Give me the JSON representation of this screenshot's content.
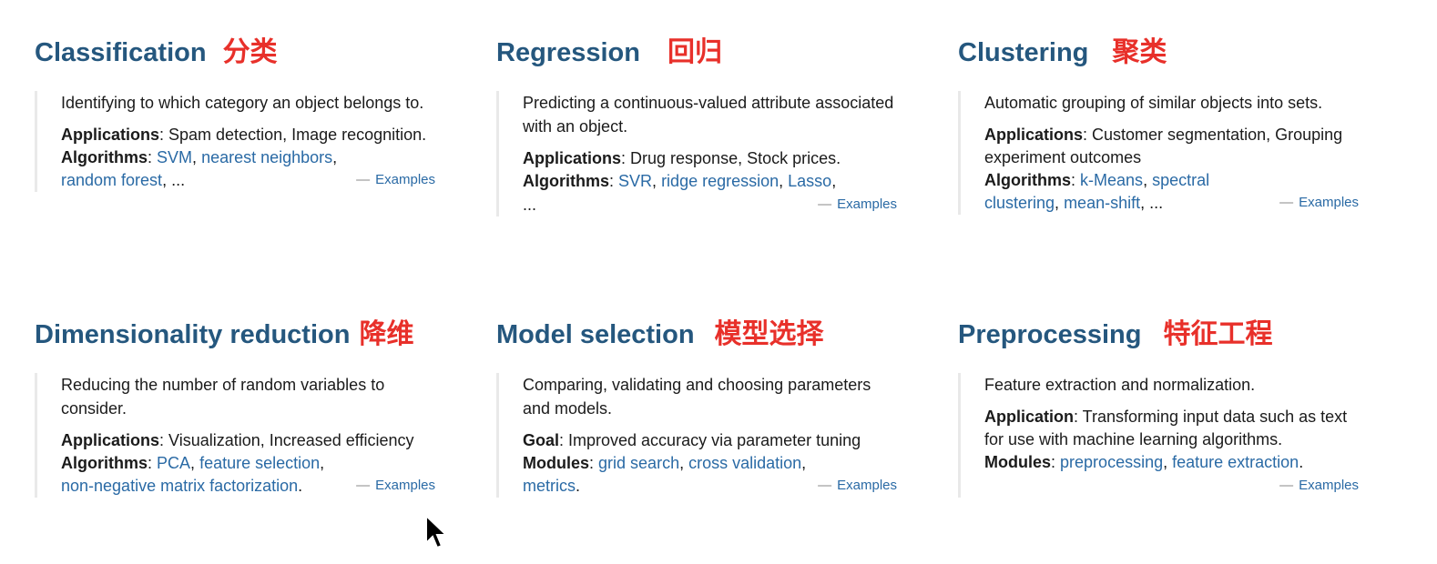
{
  "cards": [
    {
      "title": "Classification",
      "title_cn": "分类",
      "description": "Identifying to which category an object belongs to.",
      "row1_label": "Applications",
      "row1_text": ": Spam detection, Image recognition.",
      "row2_label": "Algorithms",
      "links": [
        "SVM",
        "nearest neighbors",
        "random forest"
      ],
      "ellipsis": "...",
      "examples": "Examples"
    },
    {
      "title": "Regression",
      "title_cn": "回归",
      "description": "Predicting a continuous-valued attribute associated with an object.",
      "row1_label": "Applications",
      "row1_text": ": Drug response, Stock prices.",
      "row2_label": "Algorithms",
      "links": [
        "SVR",
        "ridge regression",
        "Lasso"
      ],
      "ellipsis": "...",
      "examples": "Examples"
    },
    {
      "title": "Clustering",
      "title_cn": "聚类",
      "description": "Automatic grouping of similar objects into sets.",
      "row1_label": "Applications",
      "row1_text": ": Customer segmentation, Grouping experiment outcomes",
      "row2_label": "Algorithms",
      "links": [
        "k-Means",
        "spectral clustering",
        "mean-shift"
      ],
      "ellipsis": "...",
      "examples": "Examples"
    },
    {
      "title": "Dimensionality reduction",
      "title_cn": "降维",
      "description": "Reducing the number of random variables to consider.",
      "row1_label": "Applications",
      "row1_text": ": Visualization, Increased efficiency",
      "row2_label": "Algorithms",
      "links": [
        "PCA",
        "feature selection",
        "non-negative matrix factorization"
      ],
      "examples": "Examples"
    },
    {
      "title": "Model selection",
      "title_cn": "模型选择",
      "description": "Comparing, validating and choosing parameters and models.",
      "row1_label": "Goal",
      "row1_text": ": Improved accuracy via parameter tuning",
      "row2_label": "Modules",
      "links": [
        "grid search",
        "cross validation",
        "metrics"
      ],
      "examples": "Examples"
    },
    {
      "title": "Preprocessing",
      "title_cn": "特征工程",
      "description": "Feature extraction and normalization.",
      "row1_label": "Application",
      "row1_text": ": Transforming input data such as text for use with machine learning algorithms.",
      "row2_label": "Modules",
      "links": [
        "preprocessing",
        "feature extraction"
      ],
      "examples": "Examples"
    }
  ],
  "colors": {
    "title": "#25577e",
    "title_cn": "#e8302a",
    "link": "#2a6aa5",
    "border": "#e9e9e9"
  },
  "icons": {
    "cursor": "mouse-pointer-icon"
  }
}
